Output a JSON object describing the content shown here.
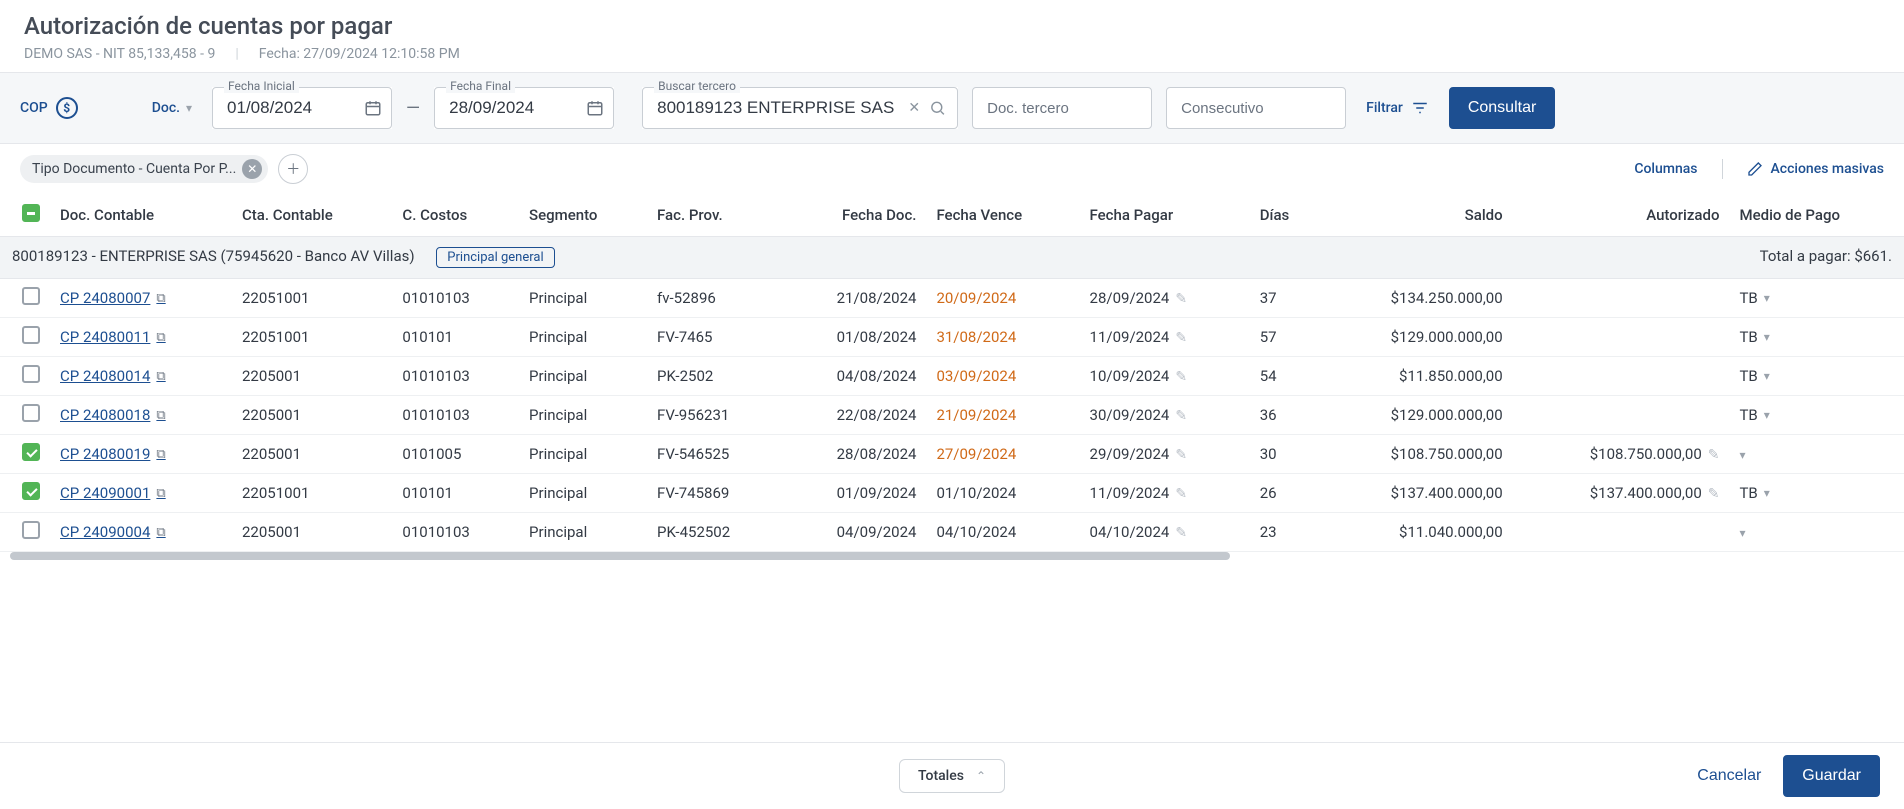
{
  "header": {
    "title": "Autorización de cuentas por pagar",
    "company": "DEMO SAS - NIT 85,133,458 - 9",
    "timestamp": "Fecha: 27/09/2024 12:10:58 PM"
  },
  "filters": {
    "currency": "COP",
    "doc_label": "Doc.",
    "fecha_inicial_label": "Fecha Inicial",
    "fecha_inicial": "01/08/2024",
    "fecha_final_label": "Fecha Final",
    "fecha_final": "28/09/2024",
    "buscar_tercero_label": "Buscar tercero",
    "buscar_tercero": "800189123 ENTERPRISE SAS",
    "doc_tercero_placeholder": "Doc. tercero",
    "consecutivo_placeholder": "Consecutivo",
    "filtrar_label": "Filtrar",
    "consultar_label": "Consultar"
  },
  "chips": {
    "tipo_doc": "Tipo Documento - Cuenta Por P..."
  },
  "table_actions": {
    "columnas": "Columnas",
    "masivas": "Acciones masivas"
  },
  "columns": {
    "doc_contable": "Doc. Contable",
    "cta_contable": "Cta. Contable",
    "c_costos": "C. Costos",
    "segmento": "Segmento",
    "fac_prov": "Fac. Prov.",
    "fecha_doc": "Fecha Doc.",
    "fecha_vence": "Fecha Vence",
    "fecha_pagar": "Fecha Pagar",
    "dias": "Días",
    "saldo": "Saldo",
    "autorizado": "Autorizado",
    "medio_pago": "Medio de Pago"
  },
  "group": {
    "header": "800189123 - ENTERPRISE SAS (75945620 - Banco AV Villas)",
    "badge": "Principal general",
    "total": "Total a pagar: $661."
  },
  "rows": [
    {
      "checked": false,
      "doc": "CP 24080007",
      "cta": "22051001",
      "cc": "01010103",
      "seg": "Principal",
      "fac": "fv-52896",
      "fdoc": "21/08/2024",
      "fven": "20/09/2024",
      "fven_over": true,
      "fpag": "28/09/2024",
      "dias": "37",
      "saldo": "$134.250.000,00",
      "auth": "",
      "medio": "TB"
    },
    {
      "checked": false,
      "doc": "CP 24080011",
      "cta": "22051001",
      "cc": "010101",
      "seg": "Principal",
      "fac": "FV-7465",
      "fdoc": "01/08/2024",
      "fven": "31/08/2024",
      "fven_over": true,
      "fpag": "11/09/2024",
      "dias": "57",
      "saldo": "$129.000.000,00",
      "auth": "",
      "medio": "TB"
    },
    {
      "checked": false,
      "doc": "CP 24080014",
      "cta": "2205001",
      "cc": "01010103",
      "seg": "Principal",
      "fac": "PK-2502",
      "fdoc": "04/08/2024",
      "fven": "03/09/2024",
      "fven_over": true,
      "fpag": "10/09/2024",
      "dias": "54",
      "saldo": "$11.850.000,00",
      "auth": "",
      "medio": "TB"
    },
    {
      "checked": false,
      "doc": "CP 24080018",
      "cta": "2205001",
      "cc": "01010103",
      "seg": "Principal",
      "fac": "FV-956231",
      "fdoc": "22/08/2024",
      "fven": "21/09/2024",
      "fven_over": true,
      "fpag": "30/09/2024",
      "dias": "36",
      "saldo": "$129.000.000,00",
      "auth": "",
      "medio": "TB"
    },
    {
      "checked": true,
      "doc": "CP 24080019",
      "cta": "2205001",
      "cc": "0101005",
      "seg": "Principal",
      "fac": "FV-546525",
      "fdoc": "28/08/2024",
      "fven": "27/09/2024",
      "fven_over": true,
      "fpag": "29/09/2024",
      "dias": "30",
      "saldo": "$108.750.000,00",
      "auth": "$108.750.000,00",
      "medio": ""
    },
    {
      "checked": true,
      "doc": "CP 24090001",
      "cta": "22051001",
      "cc": "010101",
      "seg": "Principal",
      "fac": "FV-745869",
      "fdoc": "01/09/2024",
      "fven": "01/10/2024",
      "fven_over": false,
      "fpag": "11/09/2024",
      "dias": "26",
      "saldo": "$137.400.000,00",
      "auth": "$137.400.000,00",
      "medio": "TB"
    },
    {
      "checked": false,
      "doc": "CP 24090004",
      "cta": "2205001",
      "cc": "01010103",
      "seg": "Principal",
      "fac": "PK-452502",
      "fdoc": "04/09/2024",
      "fven": "04/10/2024",
      "fven_over": false,
      "fpag": "04/10/2024",
      "dias": "23",
      "saldo": "$11.040.000,00",
      "auth": "",
      "medio": ""
    }
  ],
  "footer": {
    "totales": "Totales",
    "cancelar": "Cancelar",
    "guardar": "Guardar"
  }
}
